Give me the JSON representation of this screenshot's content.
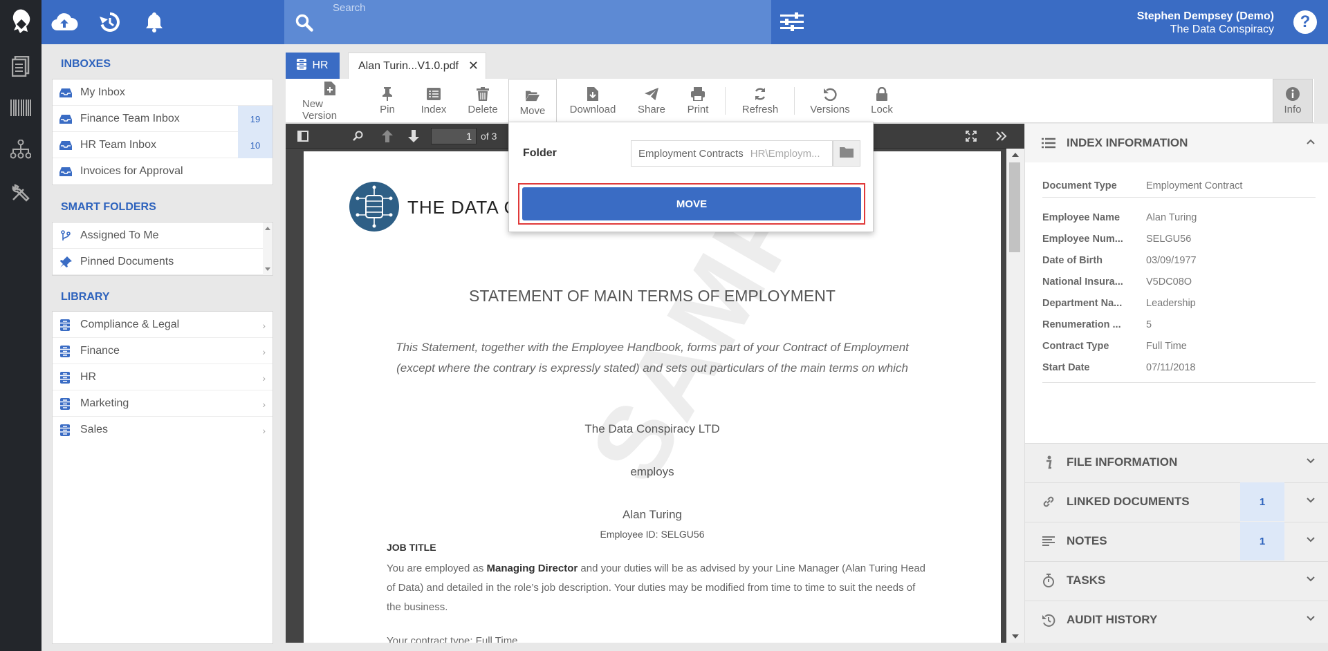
{
  "topbar": {
    "search_placeholder": "Search",
    "user_name": "Stephen Dempsey (Demo)",
    "user_org": "The Data Conspiracy",
    "help_label": "?"
  },
  "sidebar": {
    "inboxes_title": "INBOXES",
    "inboxes": [
      {
        "label": "My Inbox",
        "count": ""
      },
      {
        "label": "Finance Team Inbox",
        "count": "19"
      },
      {
        "label": "HR Team Inbox",
        "count": "10"
      },
      {
        "label": "Invoices for Approval",
        "count": ""
      }
    ],
    "smart_folders_title": "SMART FOLDERS",
    "smart_folders": [
      {
        "label": "Assigned To Me"
      },
      {
        "label": "Pinned Documents"
      }
    ],
    "library_title": "LIBRARY",
    "library": [
      {
        "label": "Compliance & Legal"
      },
      {
        "label": "Finance"
      },
      {
        "label": "HR"
      },
      {
        "label": "Marketing"
      },
      {
        "label": "Sales"
      }
    ]
  },
  "tabs": {
    "hr_label": "HR",
    "doc_label": "Alan Turin...V1.0.pdf"
  },
  "toolbar": {
    "new_version": "New Version",
    "pin": "Pin",
    "index": "Index",
    "delete": "Delete",
    "move": "Move",
    "download": "Download",
    "share": "Share",
    "print": "Print",
    "refresh": "Refresh",
    "versions": "Versions",
    "lock": "Lock",
    "info": "Info"
  },
  "viewer": {
    "page_current": "1",
    "page_total": "of 3",
    "watermark": "SAMPLE DATA"
  },
  "document": {
    "company": "THE DATA C",
    "heading": "STATEMENT OF MAIN TERMS OF EMPLOYMENT",
    "intro": "This Statement, together with the Employee Handbook, forms part of your Contract of Employment (except where the contrary is expressly stated) and sets out particulars of the main terms on which",
    "employer": "The Data Conspiracy LTD",
    "employs": "employs",
    "employee": "Alan Turing",
    "employee_id": "Employee ID: SELGU56",
    "job_title_heading": "JOB TITLE",
    "body_pre": "You are employed as ",
    "body_role": "Managing Director",
    "body_post": " and your duties will be as advised by your Line Manager (Alan Turing Head of Data) and detailed in the role’s job description. Your duties may be modified from time to time to suit the needs of the business.",
    "contract_line": "Your contract type: Full Time"
  },
  "move_popover": {
    "folder_label": "Folder",
    "folder_value": "Employment Contracts",
    "folder_path": "HR\\Employm...",
    "move_button": "MOVE"
  },
  "right_panel": {
    "index_title": "INDEX INFORMATION",
    "fields": [
      {
        "key": "Document Type",
        "value": "Employment Contract"
      },
      {
        "key": "Employee Name",
        "value": "Alan Turing"
      },
      {
        "key": "Employee Num...",
        "value": "SELGU56"
      },
      {
        "key": "Date of Birth",
        "value": "03/09/1977"
      },
      {
        "key": "National Insura...",
        "value": "V5DC08O"
      },
      {
        "key": "Department Na...",
        "value": "Leadership"
      },
      {
        "key": "Renumeration ...",
        "value": "5"
      },
      {
        "key": "Contract Type",
        "value": "Full Time"
      },
      {
        "key": "Start Date",
        "value": "07/11/2018"
      }
    ],
    "file_info_title": "FILE INFORMATION",
    "linked_title": "LINKED DOCUMENTS",
    "linked_count": "1",
    "notes_title": "NOTES",
    "notes_count": "1",
    "tasks_title": "TASKS",
    "audit_title": "AUDIT HISTORY"
  },
  "colors": {
    "brand_blue": "#3a6cc4",
    "search_blue": "#5d8ad4",
    "dark_rail": "#23262b",
    "highlight_red": "#e03a3a",
    "badge_bg": "#dde8f8"
  }
}
